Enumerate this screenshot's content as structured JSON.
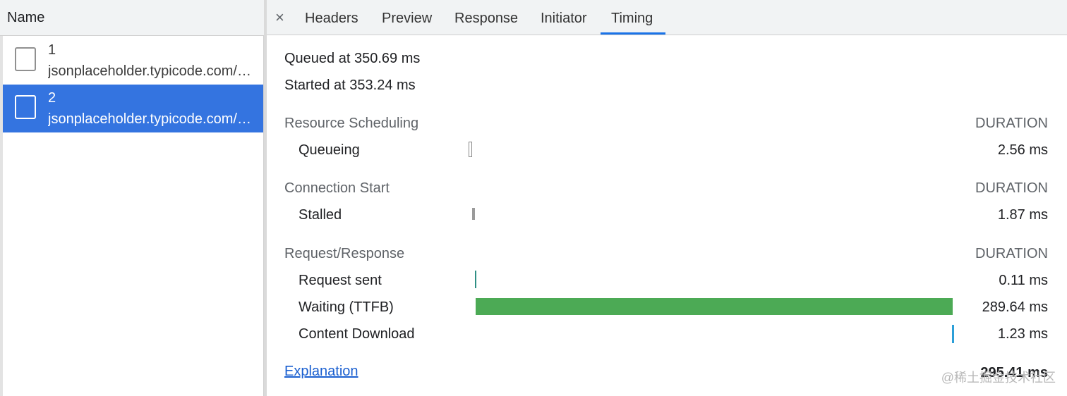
{
  "request_list": {
    "header": "Name",
    "requests": [
      {
        "name": "1",
        "url": "jsonplaceholder.typicode.com/…"
      },
      {
        "name": "2",
        "url": "jsonplaceholder.typicode.com/…"
      }
    ],
    "selected_index": 1
  },
  "tabs": {
    "close_symbol": "×",
    "items": [
      "Headers",
      "Preview",
      "Response",
      "Initiator",
      "Timing"
    ],
    "active": "Timing"
  },
  "timing": {
    "queued_at": "Queued at 350.69 ms",
    "started_at": "Started at 353.24 ms",
    "duration_label": "DURATION",
    "sections": [
      {
        "title": "Resource Scheduling",
        "phases": [
          {
            "label": "Queueing",
            "duration": "2.56 ms"
          }
        ]
      },
      {
        "title": "Connection Start",
        "phases": [
          {
            "label": "Stalled",
            "duration": "1.87 ms"
          }
        ]
      },
      {
        "title": "Request/Response",
        "phases": [
          {
            "label": "Request sent",
            "duration": "0.11 ms"
          },
          {
            "label": "Waiting (TTFB)",
            "duration": "289.64 ms"
          },
          {
            "label": "Content Download",
            "duration": "1.23 ms"
          }
        ]
      }
    ],
    "total": "295.41 ms",
    "explanation_link": "Explanation"
  },
  "colors": {
    "selected_row": "#3474e0",
    "tab_underline": "#1a73e8",
    "ttfb_bar": "#4caa55",
    "download_bar": "#2c9fd8",
    "link": "#1a5fd0"
  },
  "watermark": "@稀土掘金技术社区"
}
